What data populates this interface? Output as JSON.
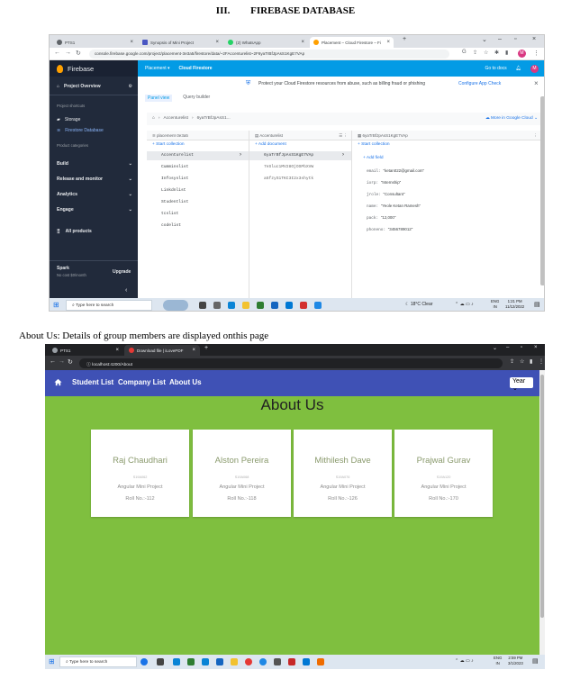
{
  "heading": {
    "number": "III.",
    "title": "FIREBASE DATABASE"
  },
  "caption": "About Us: Details of group members are displayed onthis page",
  "screenshot1": {
    "tabs": [
      {
        "label": "PTS1",
        "color": "#5f6368"
      },
      {
        "label": "Synopsis of Mini Project",
        "color": "#4a57c3"
      },
      {
        "label": "(2) WhatsApp",
        "color": "#25d366"
      },
      {
        "label": "Placement – Cloud Firestore – Fi",
        "color": "#ffa000"
      }
    ],
    "url": "console.firebase.google.com/project/placement-3e3a5/firestore/data/~2FAccenturelist~2F6yaTrBfJpAsS1KgE7VAp",
    "avatar_letter": "M",
    "firebase_brand": "Firebase",
    "sidebar": {
      "project_overview": "Project Overview",
      "shortcuts_label": "Project shortcuts",
      "storage": "Storage",
      "firestore": "Firestore Database",
      "categories_label": "Product categories",
      "categories": [
        "Build",
        "Release and monitor",
        "Analytics",
        "Engage"
      ],
      "all_products": "All products",
      "plan_name": "Spark",
      "plan_desc": "No cost $0/month",
      "upgrade": "Upgrade"
    },
    "topbar": {
      "project": "Placement",
      "section": "Cloud Firestore",
      "docs": "Go to docs"
    },
    "banner": {
      "text": "Protect your Cloud Firestore resources from abuse, such as billing fraud or phishing",
      "link": "Configure App Check"
    },
    "panel_tabs": [
      "Panel view",
      "Query builder"
    ],
    "breadcrumb": [
      "Accenturelist",
      "6yaTrBfJpAsS1..."
    ],
    "more_link": "More in Google Cloud",
    "col1": {
      "title": "placement-3e3a5",
      "action": "Start collection",
      "items": [
        "Accenturelist",
        "Cumminslist",
        "Infosyslist",
        "Linkdnlist",
        "Studentlist",
        "tcslist",
        "codelist"
      ]
    },
    "col2": {
      "title": "Accenturelist",
      "action": "Add document",
      "items": [
        "6yaTrBfJpAsS1KgE7VAp",
        "7eSluc1MV28OjOSPbXVW",
        "a5fzyS1TKC3I2x3shytk"
      ]
    },
    "col3": {
      "title": "6yaTrBfJpAsS1KgE7VAp",
      "action": "Start collection",
      "add_field": "Add field",
      "fields": [
        {
          "key": "email:",
          "value": "\"ketan022@gmail.com\""
        },
        {
          "key": "iorp:",
          "value": "\"Internship\""
        },
        {
          "key": "jrole:",
          "value": "\"Consultant\""
        },
        {
          "key": "name:",
          "value": "\"Yeole Ketan Ramesh\""
        },
        {
          "key": "pack:",
          "value": "\"12,000\""
        },
        {
          "key": "phoneno:",
          "value": "\"3456789012\""
        }
      ]
    },
    "taskbar": {
      "search": "Type here to search",
      "weather": "18°C  Clear",
      "lang": "ENG",
      "region": "IN",
      "time": "1:21 PM",
      "date": "11/12/2022"
    }
  },
  "screenshot2": {
    "tabs": [
      {
        "label": "PTS1"
      },
      {
        "label": "Download file | iLovePDF"
      }
    ],
    "url": "localhost:4200/About",
    "nav": [
      "Student List",
      "Company List",
      "About Us"
    ],
    "year_select": "Year",
    "page_title": "About Us",
    "members": [
      {
        "name": "Raj Chaudhari",
        "sub": "S19A062",
        "project": "Angular Mini Project",
        "roll": "Roll No.:-112"
      },
      {
        "name": "Alston Pereira",
        "sub": "S19A068",
        "project": "Angular Mini Project",
        "roll": "Roll No.:-118"
      },
      {
        "name": "Mithilesh Dave",
        "sub": "S19A076",
        "project": "Angular Mini Project",
        "roll": "Roll No.:-126"
      },
      {
        "name": "Prajwal Gurav",
        "sub": "S19A120",
        "project": "Angular Mini Project",
        "roll": "Roll No.:-170"
      }
    ],
    "taskbar": {
      "search": "Type here to search",
      "lang": "ENG",
      "region": "IN",
      "time": "2:59 PM",
      "date": "3/1/2023"
    }
  }
}
